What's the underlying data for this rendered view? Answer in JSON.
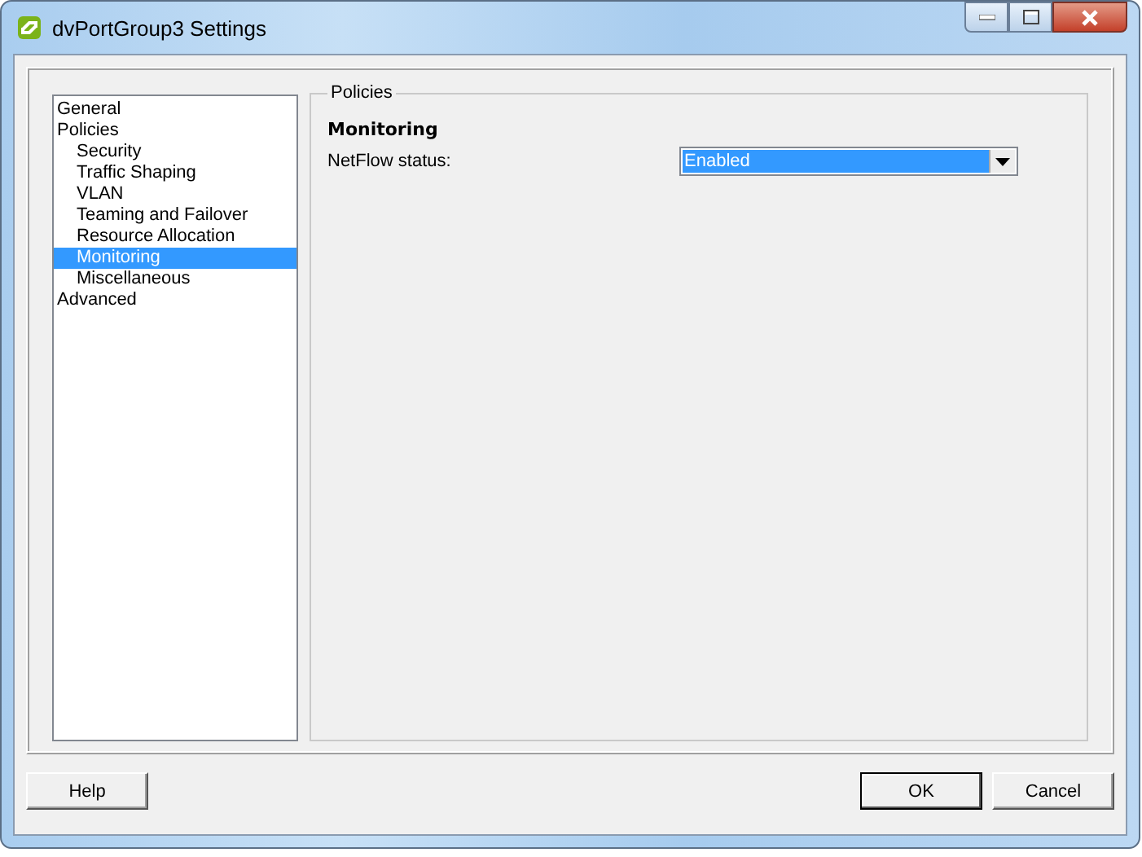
{
  "window": {
    "title": "dvPortGroup3 Settings"
  },
  "sidebar": {
    "items": [
      {
        "label": "General",
        "selected": false
      },
      {
        "label": "Policies",
        "selected": false,
        "children": [
          {
            "label": "Security",
            "selected": false
          },
          {
            "label": "Traffic Shaping",
            "selected": false
          },
          {
            "label": "VLAN",
            "selected": false
          },
          {
            "label": "Teaming and Failover",
            "selected": false
          },
          {
            "label": "Resource Allocation",
            "selected": false
          },
          {
            "label": "Monitoring",
            "selected": true
          },
          {
            "label": "Miscellaneous",
            "selected": false
          }
        ]
      },
      {
        "label": "Advanced",
        "selected": false
      }
    ]
  },
  "group": {
    "legend": "Policies",
    "heading": "Monitoring",
    "fields": [
      {
        "label": "NetFlow status:",
        "value": "Enabled",
        "focused": true
      }
    ]
  },
  "buttons": [
    {
      "label": "Help",
      "default": false
    },
    {
      "label": "OK",
      "default": true
    },
    {
      "label": "Cancel",
      "default": false
    }
  ]
}
